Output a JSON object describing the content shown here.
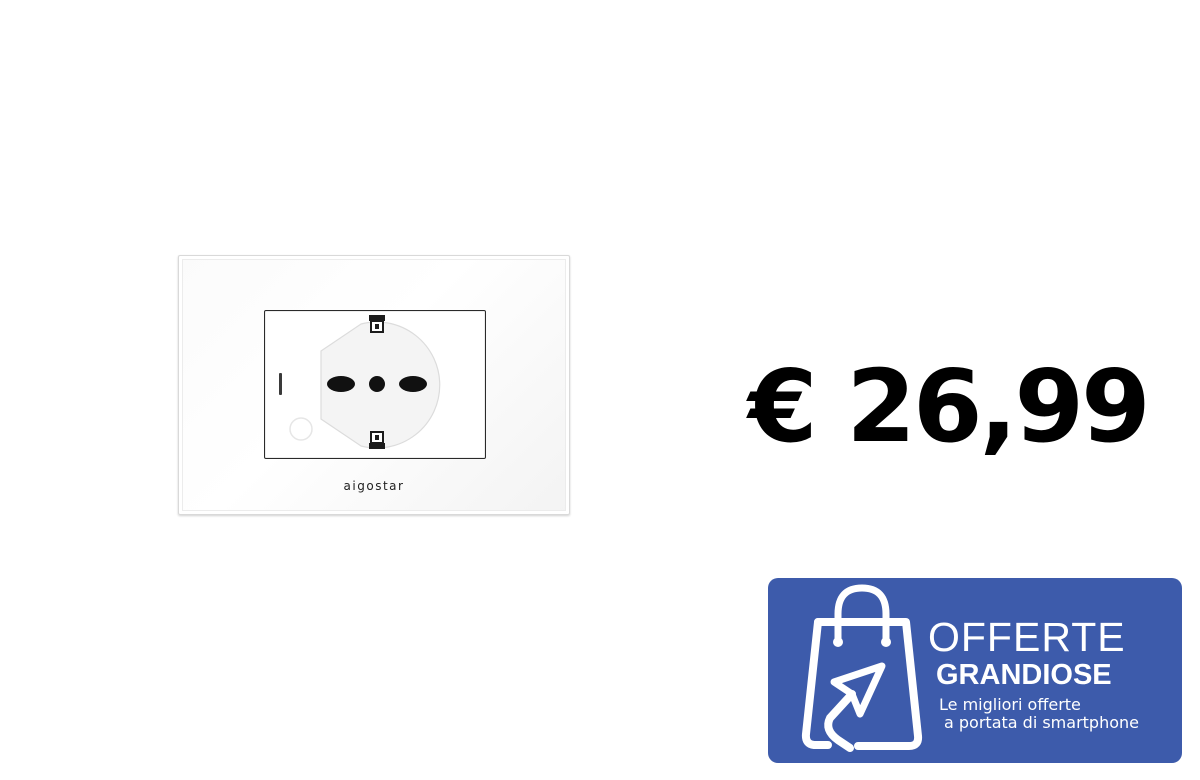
{
  "product": {
    "brand": "aigostar",
    "icon": "wall-socket-image"
  },
  "price": {
    "text": "€ 26,99"
  },
  "promo": {
    "title_line1": "OFFERTE",
    "title_line2": "GRANDIOSE",
    "subtitle_line1": "Le migliori offerte",
    "subtitle_line2": "a portata di smartphone",
    "icon": "shopping-bag-cursor-icon",
    "background_color": "#3d5bab",
    "text_color": "#ffffff"
  }
}
